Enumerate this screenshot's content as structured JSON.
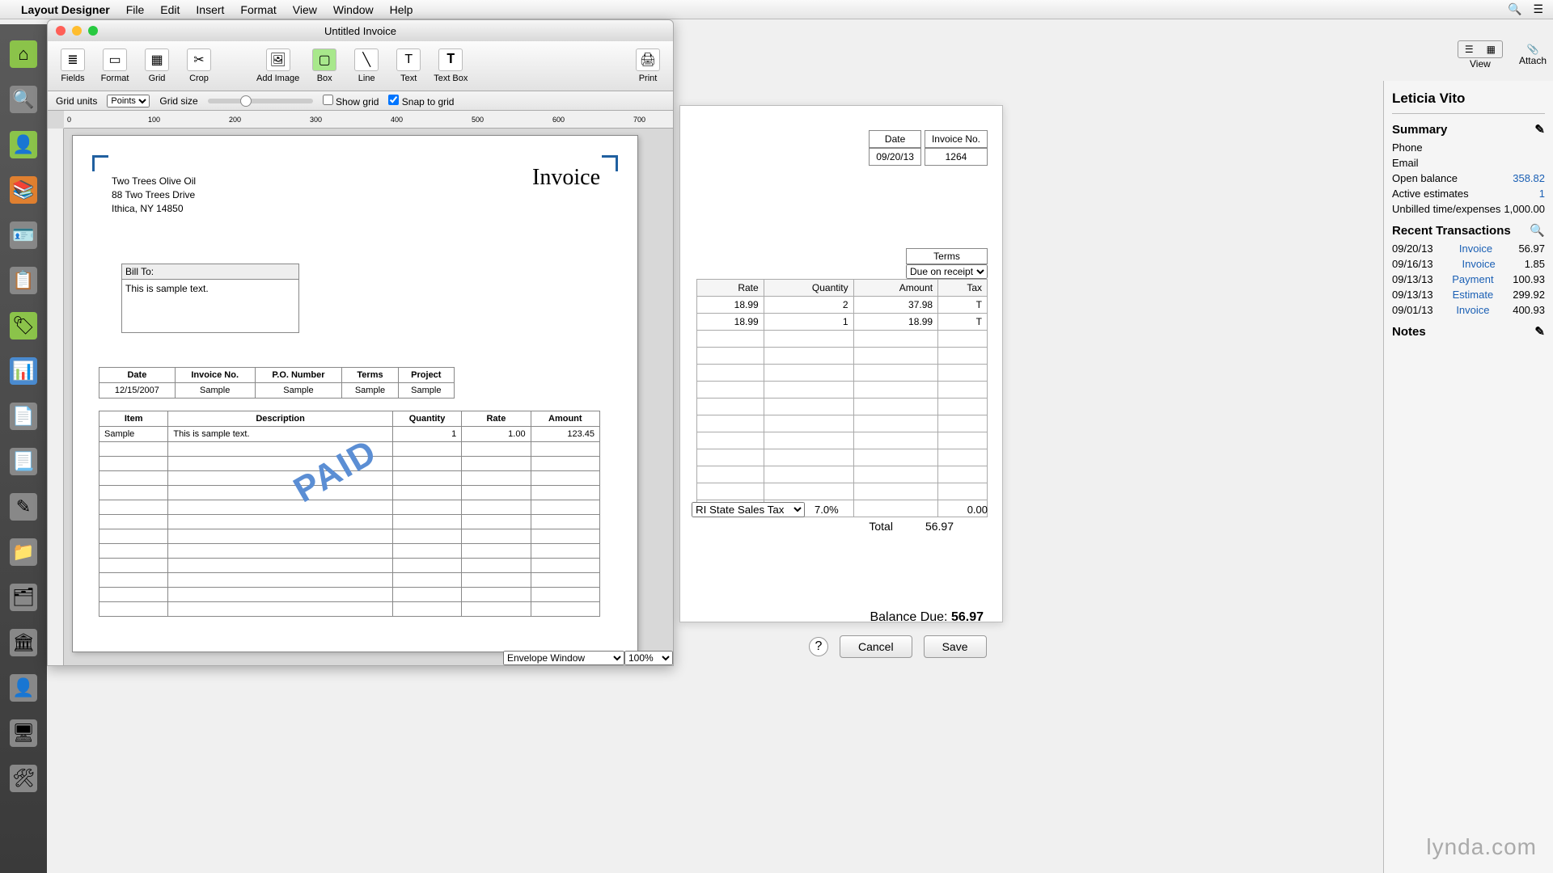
{
  "menubar": {
    "app": "Layout Designer",
    "items": [
      "File",
      "Edit",
      "Insert",
      "Format",
      "View",
      "Window",
      "Help"
    ]
  },
  "window_title": "Untitled Invoice",
  "toolbar": {
    "fields": "Fields",
    "format": "Format",
    "grid": "Grid",
    "crop": "Crop",
    "add_image": "Add Image",
    "box": "Box",
    "line": "Line",
    "text": "Text",
    "textbox": "Text Box",
    "print": "Print"
  },
  "optbar": {
    "grid_units_label": "Grid units",
    "grid_units_value": "Points",
    "grid_size_label": "Grid size",
    "show_grid": "Show grid",
    "snap": "Snap to grid"
  },
  "ruler_marks": [
    "0",
    "100",
    "200",
    "300",
    "400",
    "500",
    "600",
    "700"
  ],
  "company": {
    "name": "Two Trees Olive Oil",
    "addr1": "88 Two Trees Drive",
    "addr2": "Ithica, NY 14850"
  },
  "invoice_title": "Invoice",
  "billto": {
    "label": "Bill To:",
    "text": "This is sample text."
  },
  "tbl1": {
    "headers": [
      "Date",
      "Invoice No.",
      "P.O. Number",
      "Terms",
      "Project"
    ],
    "row": [
      "12/15/2007",
      "Sample",
      "Sample",
      "Sample",
      "Sample"
    ]
  },
  "tbl2": {
    "headers": [
      "Item",
      "Description",
      "Quantity",
      "Rate",
      "Amount"
    ],
    "row": [
      "Sample",
      "This is sample text.",
      "1",
      "1.00",
      "123.45"
    ]
  },
  "watermark": "PAID",
  "bottombar": {
    "envelope": "Envelope Window",
    "zoom": "100%"
  },
  "invoice_panel": {
    "date_label": "Date",
    "date": "09/20/13",
    "no_label": "Invoice No.",
    "no": "1264",
    "terms_label": "Terms",
    "terms_value": "Due on receipt",
    "cols": [
      "Rate",
      "Quantity",
      "Amount",
      "Tax"
    ],
    "rows": [
      [
        "18.99",
        "2",
        "37.98",
        "T"
      ],
      [
        "18.99",
        "1",
        "18.99",
        "T"
      ]
    ],
    "tax_name": "RI State Sales Tax",
    "tax_rate": "7.0%",
    "tax_amt": "0.00",
    "total_label": "Total",
    "total": "56.97",
    "balance_label": "Balance Due:",
    "balance": "56.97",
    "cancel": "Cancel",
    "save": "Save"
  },
  "side_toolbar": {
    "view": "View",
    "attach": "Attach"
  },
  "sidebar": {
    "name": "Leticia Vito",
    "summary": "Summary",
    "phone": "Phone",
    "email": "Email",
    "open_balance_l": "Open balance",
    "open_balance_v": "358.82",
    "active_est_l": "Active estimates",
    "active_est_v": "1",
    "unbilled_l": "Unbilled time/expenses",
    "unbilled_v": "1,000.00",
    "recent": "Recent Transactions",
    "trans": [
      {
        "d": "09/20/13",
        "t": "Invoice",
        "a": "56.97"
      },
      {
        "d": "09/16/13",
        "t": "Invoice",
        "a": "1.85"
      },
      {
        "d": "09/13/13",
        "t": "Payment",
        "a": "100.93"
      },
      {
        "d": "09/13/13",
        "t": "Estimate",
        "a": "299.92"
      },
      {
        "d": "09/01/13",
        "t": "Invoice",
        "a": "400.93"
      }
    ],
    "notes": "Notes"
  },
  "brand": "lynda.com"
}
